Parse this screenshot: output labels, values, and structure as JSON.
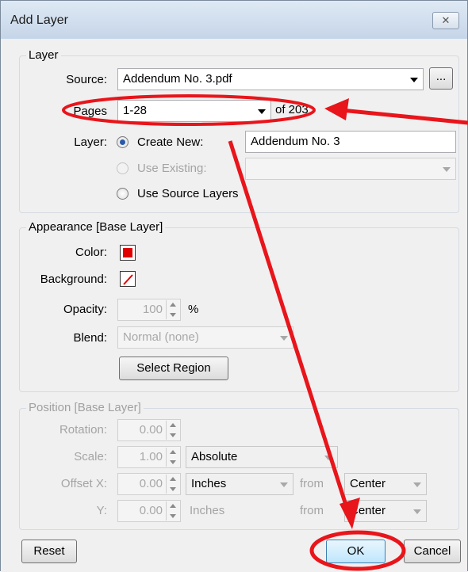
{
  "window": {
    "title": "Add Layer",
    "close_glyph": "✕"
  },
  "layer_group": {
    "legend": "Layer",
    "source_label": "Source:",
    "source_value": "Addendum No. 3.pdf",
    "browse_label": "...",
    "pages_label": "Pages",
    "pages_value": "1-28",
    "pages_of": "of 203",
    "layer_label": "Layer:",
    "create_new_label": "Create New:",
    "create_new_value": "Addendum No. 3",
    "use_existing_label": "Use Existing:",
    "use_existing_value": "",
    "use_source_layers_label": "Use Source Layers"
  },
  "appearance_group": {
    "legend": "Appearance [Base Layer]",
    "color_label": "Color:",
    "color_value": "#e00000",
    "background_label": "Background:",
    "opacity_label": "Opacity:",
    "opacity_value": "100",
    "opacity_unit": "%",
    "blend_label": "Blend:",
    "blend_value": "Normal (none)",
    "select_region_label": "Select Region"
  },
  "position_group": {
    "legend": "Position [Base Layer]",
    "rotation_label": "Rotation:",
    "rotation_value": "0.00",
    "scale_label": "Scale:",
    "scale_value": "1.00",
    "scale_mode": "Absolute",
    "offset_x_label": "Offset X:",
    "offset_x_value": "0.00",
    "offset_x_unit": "Inches",
    "offset_x_from_label": "from",
    "offset_x_from": "Center",
    "offset_y_label": "Y:",
    "offset_y_value": "0.00",
    "offset_y_unit": "Inches",
    "offset_y_from_label": "from",
    "offset_y_from": "Center"
  },
  "footer": {
    "reset_label": "Reset",
    "ok_label": "OK",
    "cancel_label": "Cancel"
  },
  "annotation_color": "#e8151b"
}
